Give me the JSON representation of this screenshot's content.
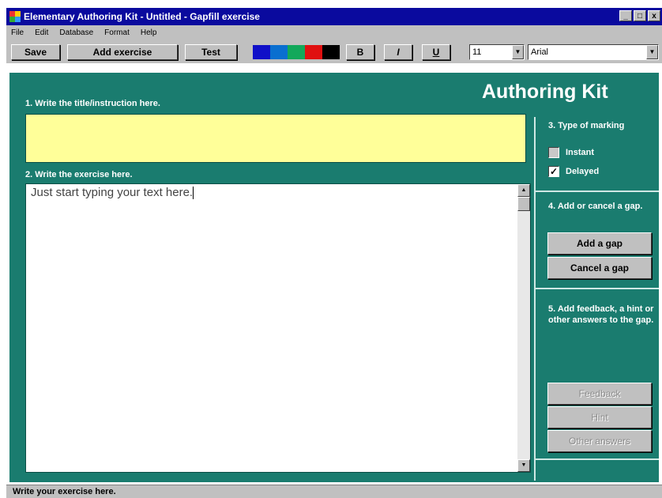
{
  "window": {
    "title": "Elementary Authoring Kit - Untitled - Gapfill exercise",
    "minimize_label": "_",
    "maximize_label": "□",
    "close_label": "x"
  },
  "menu": {
    "items": [
      "File",
      "Edit",
      "Database",
      "Format",
      "Help"
    ]
  },
  "toolbar": {
    "save_label": "Save",
    "add_exercise_label": "Add exercise",
    "test_label": "Test",
    "color_swatches": [
      "#1010c8",
      "#0a6fd0",
      "#12a85a",
      "#e01010",
      "#000000"
    ],
    "bold_label": "B",
    "italic_label": "I",
    "underline_label": "U",
    "font_size_value": "11",
    "font_name_value": "Arial"
  },
  "main": {
    "heading": "Authoring Kit",
    "step1_label": "1. Write the title/instruction here.",
    "title_value": "",
    "step2_label": "2. Write the exercise here.",
    "exercise_text": "Just start typing your text here."
  },
  "side": {
    "step3_label": "3. Type of marking",
    "instant_label": "Instant",
    "instant_checked": false,
    "delayed_label": "Delayed",
    "delayed_checked": true,
    "check_mark": "✓",
    "step4_label": "4. Add or cancel a gap.",
    "add_gap_label": "Add a gap",
    "cancel_gap_label": "Cancel a gap",
    "step5_label": "5. Add feedback, a hint or other answers to the gap.",
    "feedback_label": "Feedback",
    "hint_label": "Hint",
    "other_answers_label": "Other answers"
  },
  "status": {
    "text": "Write your exercise here."
  },
  "colors": {
    "panel": "#1a7c6f",
    "title_bar": "#0a0a9e",
    "title_field": "#ffff99"
  }
}
